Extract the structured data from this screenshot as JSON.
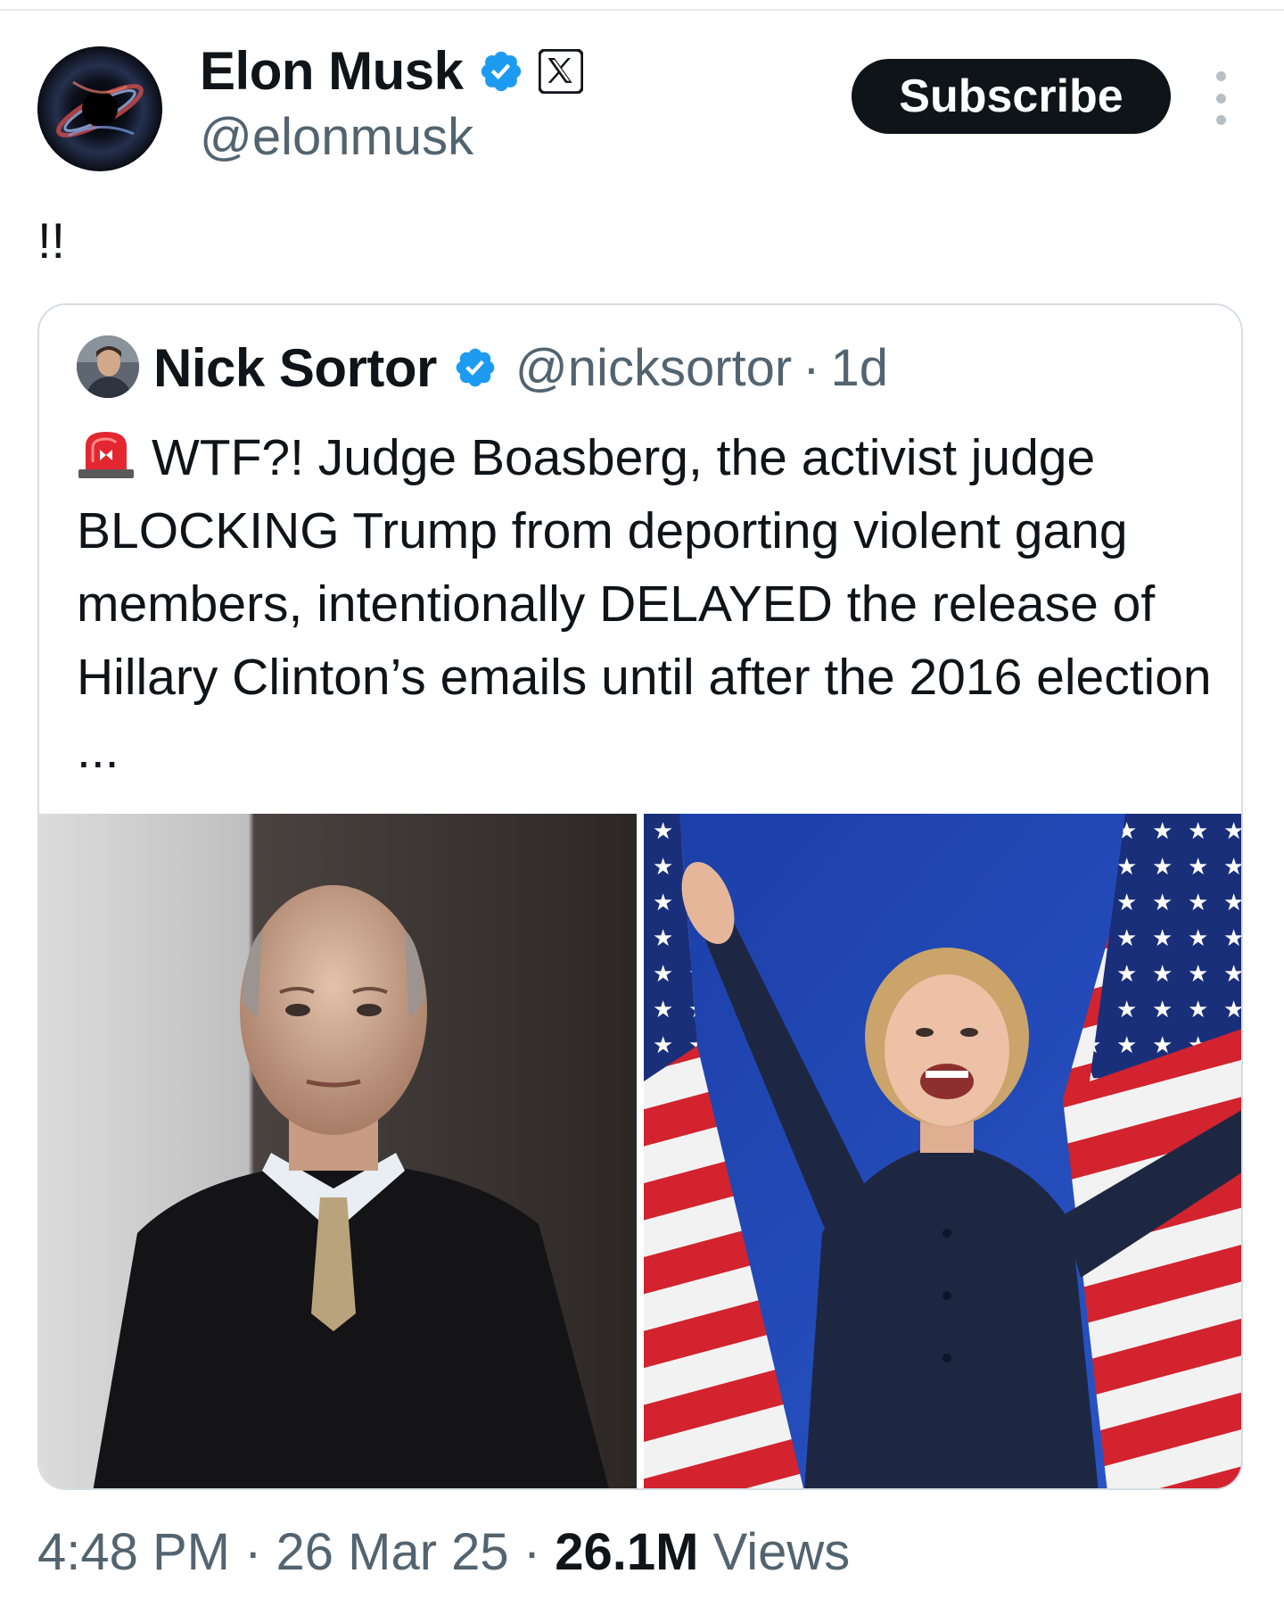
{
  "author": {
    "name": "Elon Musk",
    "handle": "@elonmusk",
    "verified_icon": "verified-badge-icon",
    "affiliate_icon": "x-logo-icon",
    "avatar_icon": "black-hole-avatar"
  },
  "actions": {
    "subscribe_label": "Subscribe",
    "more_icon": "more-vertical-icon"
  },
  "post": {
    "text": "!!"
  },
  "quote": {
    "name": "Nick Sortor",
    "handle": "@nicksortor",
    "separator": "·",
    "time": "1d",
    "siren_icon": "police-siren-emoji",
    "text": "WTF?! Judge Boasberg, the activist judge BLOCKING Trump from deporting violent gang members, intentionally DELAYED the release of Hillary Clinton’s emails until after the 2016 election ...",
    "media": [
      {
        "kind": "photo",
        "icon": "photo-judge-in-robe"
      },
      {
        "kind": "photo",
        "icon": "photo-woman-with-american-flags"
      }
    ]
  },
  "meta": {
    "time": "4:48 PM",
    "sep1": " · ",
    "date": "26 Mar 25",
    "sep2": " · ",
    "views_count": "26.1M",
    "views_label": " Views"
  },
  "colors": {
    "text_primary": "#0f1419",
    "text_secondary": "#536471",
    "verified_blue": "#1d9bf0",
    "border": "#d6dde3",
    "button_bg": "#0f1419"
  }
}
